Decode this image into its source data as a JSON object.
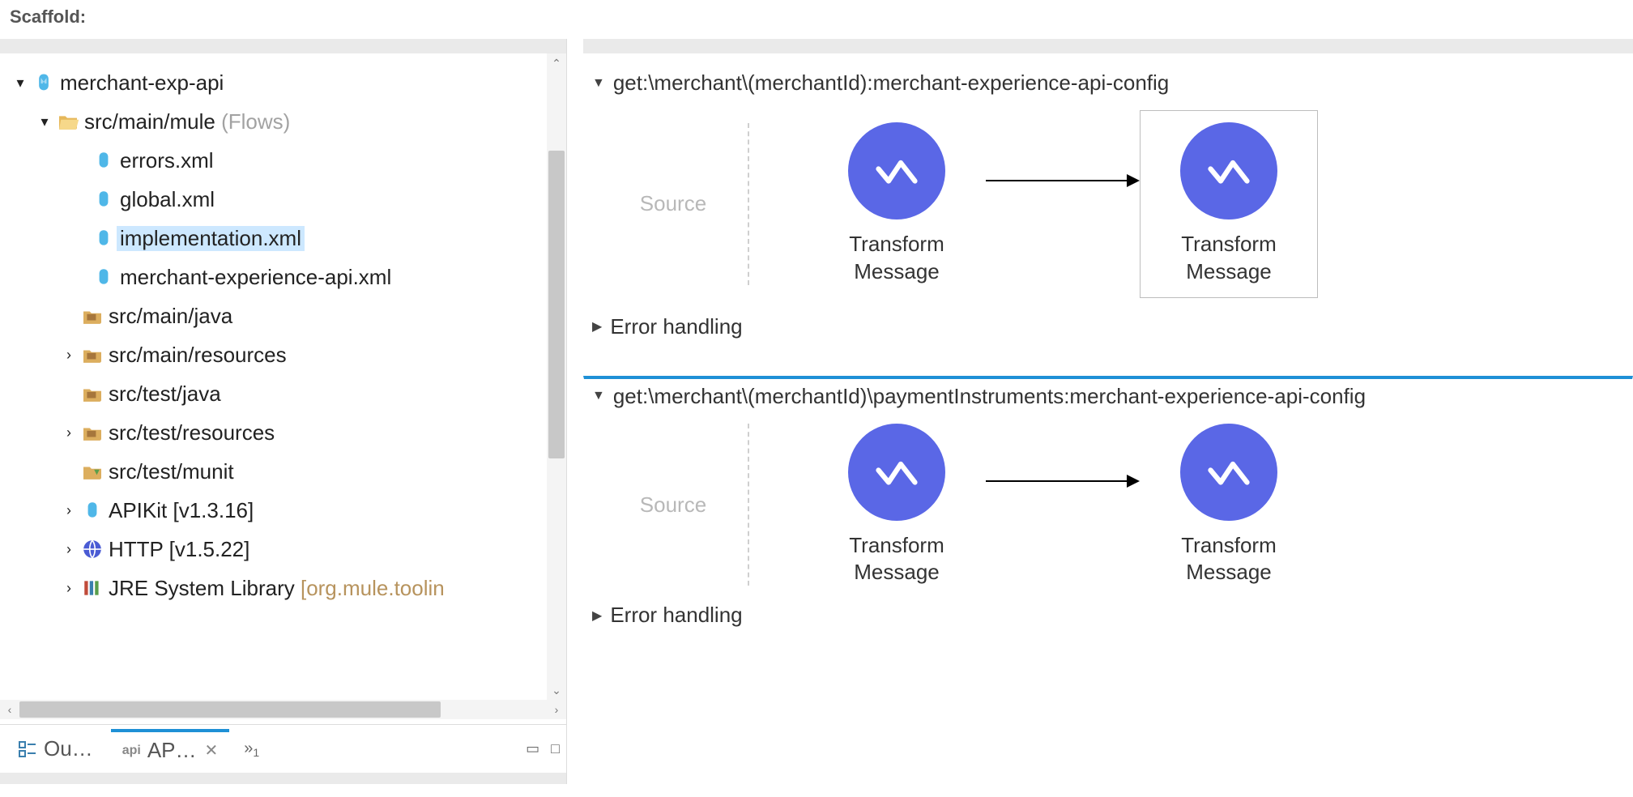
{
  "heading": "Scaffold:",
  "tree": {
    "project": "merchant-exp-api",
    "flowsFolder": "src/main/mule",
    "flowsSuffix": "(Flows)",
    "files": {
      "errors": "errors.xml",
      "global": "global.xml",
      "implementation": "implementation.xml",
      "merchantApi": "merchant-experience-api.xml"
    },
    "folders": {
      "mainJava": "src/main/java",
      "mainResources": "src/main/resources",
      "testJava": "src/test/java",
      "testResources": "src/test/resources",
      "testMunit": "src/test/munit"
    },
    "libs": {
      "apikit": "APIKit [v1.3.16]",
      "http": "HTTP [v1.5.22]",
      "jre": "JRE System Library",
      "jreSuffix": "[org.mule.toolin"
    }
  },
  "tabs": {
    "outline": "Ou…",
    "api": "AP…",
    "overflowCount": "1"
  },
  "flows": [
    {
      "title": "get:\\merchant\\(merchantId):merchant-experience-api-config",
      "sourceLabel": "Source",
      "node1": "Transform Message",
      "node2": "Transform Message",
      "errorLabel": "Error handling",
      "active": false,
      "node2Boxed": true
    },
    {
      "title": "get:\\merchant\\(merchantId)\\paymentInstruments:merchant-experience-api-config",
      "sourceLabel": "Source",
      "node1": "Transform Message",
      "node2": "Transform Message",
      "errorLabel": "Error handling",
      "active": true,
      "node2Boxed": false
    }
  ]
}
